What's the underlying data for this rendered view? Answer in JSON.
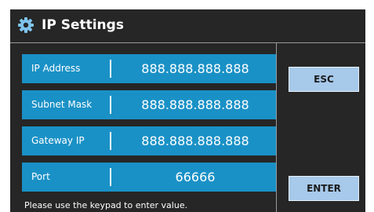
{
  "window": {
    "title": "IP Settings",
    "title_icon": "gear-icon"
  },
  "fields": [
    {
      "label": "IP Address",
      "value": "888.888.888.888"
    },
    {
      "label": "Subnet Mask",
      "value": "888.888.888.888"
    },
    {
      "label": "Gateway IP",
      "value": "888.888.888.888"
    },
    {
      "label": "Port",
      "value": "66666"
    }
  ],
  "buttons": {
    "esc_label": "ESC",
    "enter_label": "ENTER"
  },
  "hint": "Please use the keypad to enter value.",
  "colors": {
    "screen_bg": "#262626",
    "field_bg": "#1a91c6",
    "button_bg": "#a7c9ea",
    "text": "#ffffff"
  }
}
